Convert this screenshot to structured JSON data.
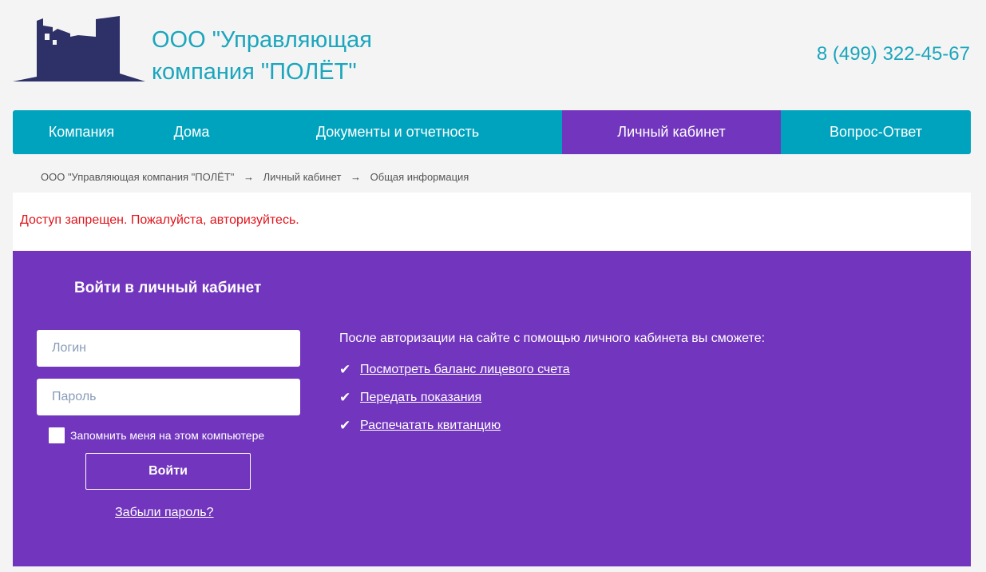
{
  "header": {
    "company_line1": "ООО \"Управляющая",
    "company_line2": "компания \"ПОЛЁТ\"",
    "phone": "8 (499) 322-45-67"
  },
  "nav": {
    "items": [
      {
        "label": "Компания"
      },
      {
        "label": "Дома"
      },
      {
        "label": "Документы и отчетность"
      },
      {
        "label": "Личный кабинет",
        "active": true
      },
      {
        "label": "Вопрос-Ответ"
      }
    ]
  },
  "breadcrumb": {
    "items": [
      "ООО \"Управляющая компания \"ПОЛЁТ\"",
      "Личный кабинет",
      "Общая информация"
    ],
    "separator": "→"
  },
  "alert": {
    "text": "Доступ запрещен. Пожалуйста, авторизуйтесь."
  },
  "login": {
    "title": "Войти в личный кабинет",
    "login_placeholder": "Логин",
    "password_placeholder": "Пароль",
    "remember_label": "Запомнить меня на этом компьютере",
    "submit_label": "Войти",
    "forgot_label": "Забыли пароль?"
  },
  "benefits": {
    "intro": "После авторизации на сайте с помощью личного кабинета вы сможете:",
    "check_glyph": "✔",
    "items": [
      {
        "label": "Посмотреть баланс лицевого счета"
      },
      {
        "label": "Передать показания"
      },
      {
        "label": "Распечатать квитанцию"
      }
    ]
  },
  "colors": {
    "teal": "#00a3be",
    "purple": "#7235bd",
    "brand_text": "#1ba6bd",
    "logo_navy": "#2e3068",
    "error": "#e0141b"
  }
}
